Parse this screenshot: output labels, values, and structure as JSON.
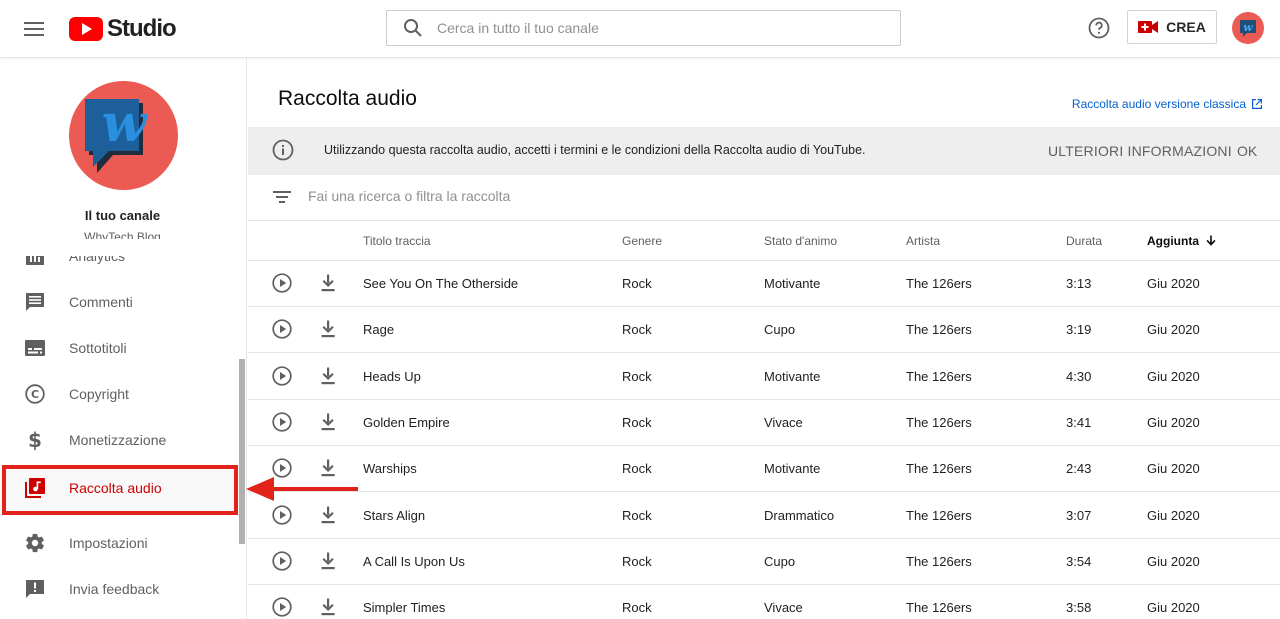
{
  "header": {
    "logo_text": "Studio",
    "search_placeholder": "Cerca in tutto il tuo canale",
    "create_label": "CREA"
  },
  "sidebar": {
    "channel_title": "Il tuo canale",
    "channel_name": "WhyTech Blog",
    "items": [
      {
        "label": "Analytics",
        "icon": "analytics-icon"
      },
      {
        "label": "Commenti",
        "icon": "comments-icon"
      },
      {
        "label": "Sottotitoli",
        "icon": "subtitles-icon"
      },
      {
        "label": "Copyright",
        "icon": "copyright-icon"
      },
      {
        "label": "Monetizzazione",
        "icon": "dollar-icon"
      },
      {
        "label": "Raccolta audio",
        "icon": "audio-library-icon",
        "active": true
      },
      {
        "label": "Impostazioni",
        "icon": "gear-icon"
      },
      {
        "label": "Invia feedback",
        "icon": "feedback-icon"
      }
    ]
  },
  "main": {
    "title": "Raccolta audio",
    "classic_link": "Raccolta audio versione classica",
    "notice": {
      "text": "Utilizzando questa raccolta audio, accetti i termini e le condizioni della Raccolta audio di YouTube.",
      "more": "ULTERIORI INFORMAZIONI",
      "ok": "OK"
    },
    "filter_placeholder": "Fai una ricerca o filtra la raccolta",
    "columns": {
      "title": "Titolo traccia",
      "genre": "Genere",
      "mood": "Stato d'animo",
      "artist": "Artista",
      "duration": "Durata",
      "added": "Aggiunta"
    },
    "tracks": [
      {
        "title": "See You On The Otherside",
        "genre": "Rock",
        "mood": "Motivante",
        "artist": "The 126ers",
        "duration": "3:13",
        "added": "Giu 2020"
      },
      {
        "title": "Rage",
        "genre": "Rock",
        "mood": "Cupo",
        "artist": "The 126ers",
        "duration": "3:19",
        "added": "Giu 2020"
      },
      {
        "title": "Heads Up",
        "genre": "Rock",
        "mood": "Motivante",
        "artist": "The 126ers",
        "duration": "4:30",
        "added": "Giu 2020"
      },
      {
        "title": "Golden Empire",
        "genre": "Rock",
        "mood": "Vivace",
        "artist": "The 126ers",
        "duration": "3:41",
        "added": "Giu 2020"
      },
      {
        "title": "Warships",
        "genre": "Rock",
        "mood": "Motivante",
        "artist": "The 126ers",
        "duration": "2:43",
        "added": "Giu 2020"
      },
      {
        "title": "Stars Align",
        "genre": "Rock",
        "mood": "Drammatico",
        "artist": "The 126ers",
        "duration": "3:07",
        "added": "Giu 2020"
      },
      {
        "title": "A Call Is Upon Us",
        "genre": "Rock",
        "mood": "Cupo",
        "artist": "The 126ers",
        "duration": "3:54",
        "added": "Giu 2020"
      },
      {
        "title": "Simpler Times",
        "genre": "Rock",
        "mood": "Vivace",
        "artist": "The 126ers",
        "duration": "3:58",
        "added": "Giu 2020"
      }
    ]
  },
  "colors": {
    "brand_red": "#ff0000",
    "active_red": "#cc0000",
    "highlight": "#e2231a",
    "link_blue": "#065fd4",
    "avatar_bg": "#ec5a54"
  }
}
